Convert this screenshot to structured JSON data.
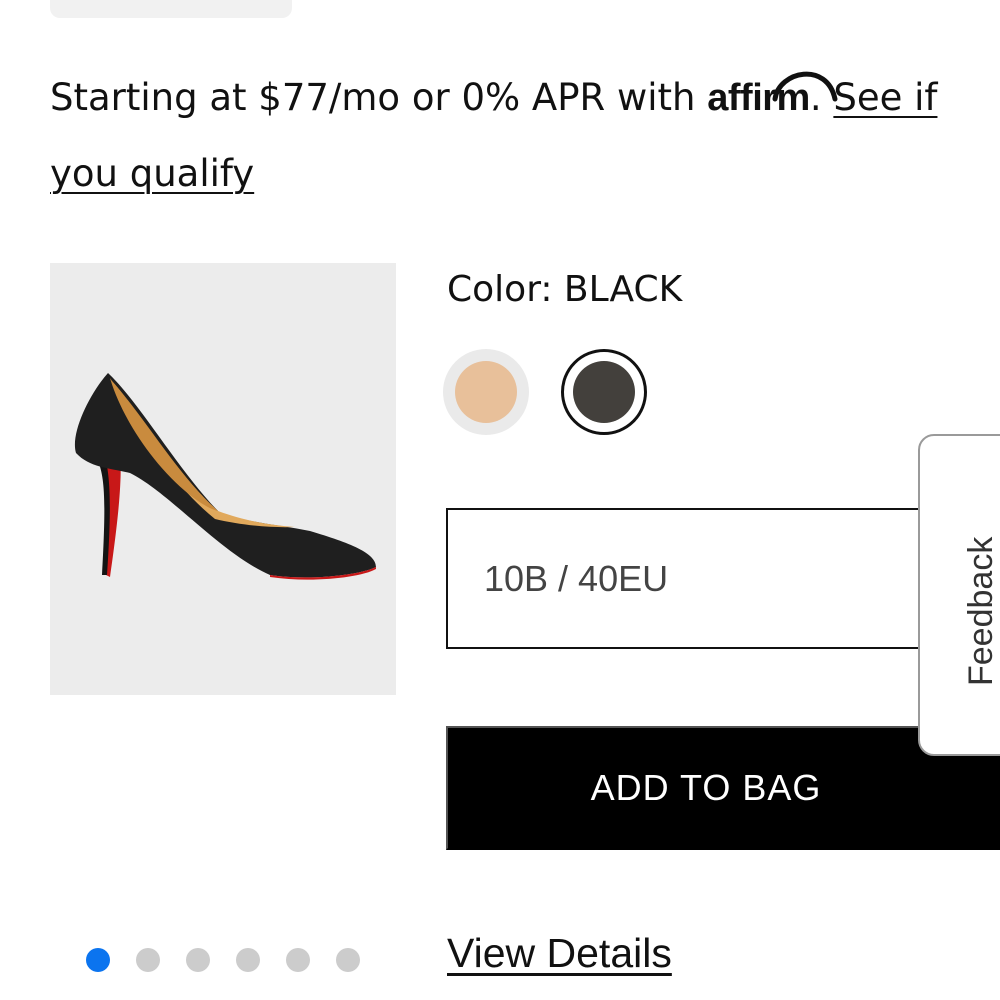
{
  "financing": {
    "text_before": "Starting at $77/mo or 0% APR with ",
    "brand": "affirm",
    "text_after": ". ",
    "link_label": "See if you qualify"
  },
  "product": {
    "image_alt_icon": "shoe-product-image"
  },
  "color": {
    "label": "Color: BLACK",
    "swatches": [
      {
        "name": "nude",
        "color": "#e8c09a",
        "selected": false
      },
      {
        "name": "black",
        "color": "#43403c",
        "selected": true
      }
    ]
  },
  "size": {
    "value": "10B / 40EU"
  },
  "cart": {
    "add_label": "ADD TO BAG"
  },
  "feedback": {
    "label": "Feedback"
  },
  "carousel": {
    "dot_count": 6,
    "active_index": 0,
    "active_color": "#0b74ef",
    "inactive_color": "#cccccc"
  },
  "details": {
    "link_label": "View Details"
  }
}
